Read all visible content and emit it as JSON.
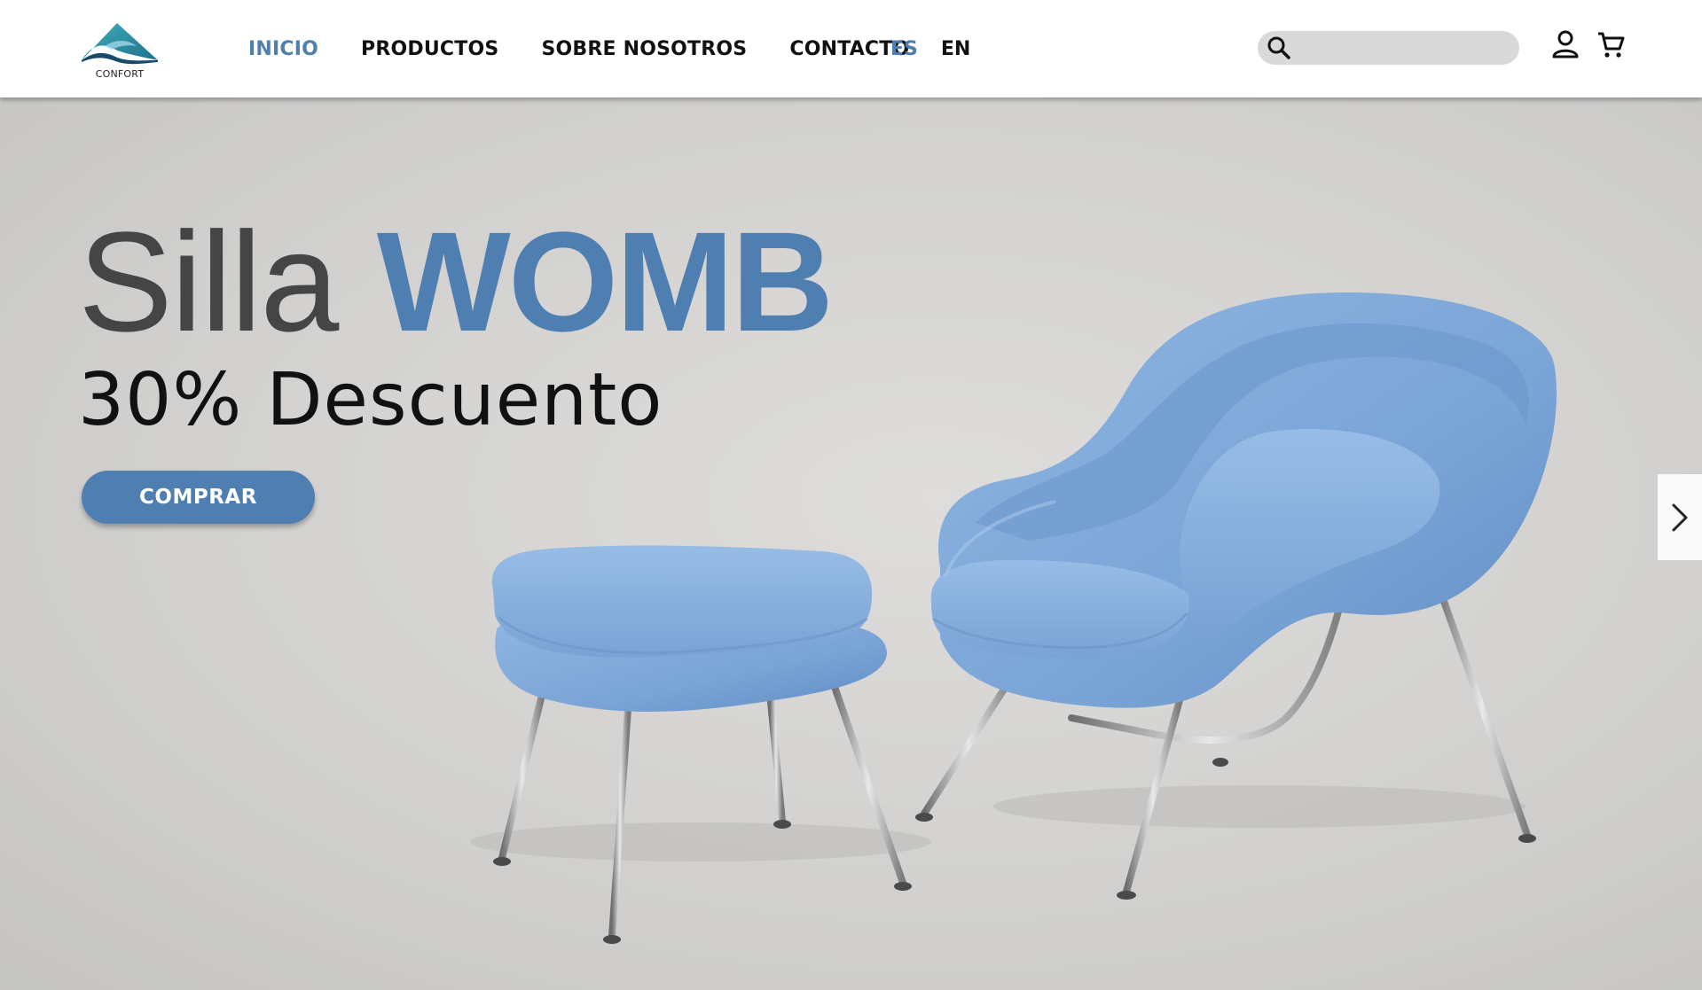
{
  "brand": {
    "name": "CONFORT"
  },
  "nav": {
    "items": [
      {
        "label": "INICIO",
        "active": true
      },
      {
        "label": "PRODUCTOS",
        "active": false
      },
      {
        "label": "SOBRE NOSOTROS",
        "active": false
      },
      {
        "label": "CONTACTO",
        "active": false
      }
    ]
  },
  "languages": [
    {
      "label": "ES",
      "active": true
    },
    {
      "label": "EN",
      "active": false
    }
  ],
  "search": {
    "placeholder": "",
    "value": "",
    "icon": "search-icon"
  },
  "header_icons": [
    "user-icon",
    "cart-icon"
  ],
  "hero": {
    "title_part1": "Silla",
    "title_part2": "WOMB",
    "subtitle": "30% Descuento",
    "cta_label": "COMPRAR",
    "next_icon": "chevron-right-icon"
  },
  "colors": {
    "accent": "#4f7fb0",
    "text_dark": "#111111",
    "title_gray": "#454545",
    "product_blue": "#80a8d8",
    "background": "#d2d2d2"
  }
}
